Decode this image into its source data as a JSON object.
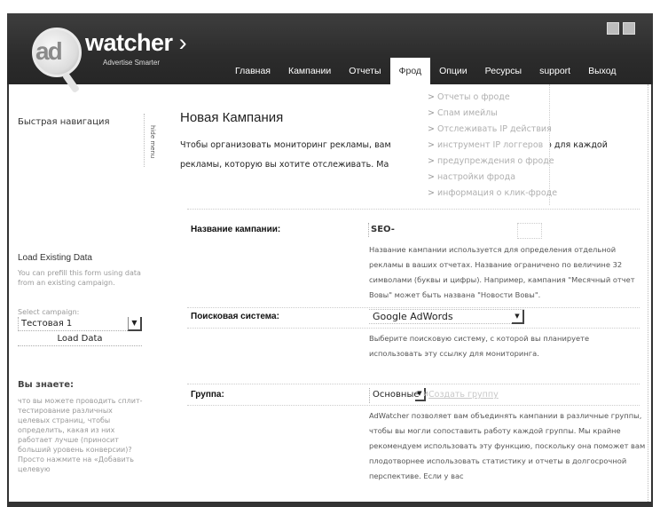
{
  "header": {
    "logo_ad": "ad",
    "logo_word": "watcher",
    "logo_chevron": "›",
    "tagline": "Advertise Smarter",
    "icons": [
      "print-icon",
      "window-icon"
    ]
  },
  "nav": {
    "items": [
      {
        "label": "Главная",
        "active": false
      },
      {
        "label": "Кампании",
        "active": false
      },
      {
        "label": "Отчеты",
        "active": false
      },
      {
        "label": "Фрод",
        "active": true
      },
      {
        "label": "Опции",
        "active": false
      },
      {
        "label": "Ресурсы",
        "active": false
      },
      {
        "label": "support",
        "active": false
      },
      {
        "label": "Выход",
        "active": false
      }
    ]
  },
  "fraud_menu": {
    "items": [
      "Отчеты о фроде",
      "Спам имейлы",
      "Отслеживать IP действия",
      "инструмент IP логгеров",
      "предупреждения о фроде",
      "настройки фрода",
      "информация о клик-фроде"
    ]
  },
  "sidebar": {
    "quick_nav": "Быстрая навигация",
    "hide_menu": "hide menu",
    "load_title": "Load Existing Data",
    "load_desc": "You can prefill this form using data from an existing campaign.",
    "select_label": "Select campaign:",
    "selected_campaign": "Тестовая 1",
    "load_button": "Load Data",
    "know_title": "Вы знаете:",
    "know_text": "что вы можете проводить сплит-тестирование различных целевых страниц, чтобы определить, какая из них работает лучше (приносит больший уровень конверсии)? Просто нажмите на «Добавить целевую"
  },
  "main": {
    "title": "Новая Кампания",
    "intro_line1": "Чтобы организовать мониторинг рекламы, вам",
    "intro_line1_end": "о для каждой",
    "intro_line2": "рекламы, которую вы хотите отслеживать. Ма",
    "campaign_name": {
      "label": "Название кампании:",
      "value": "SEO-",
      "help": "Название кампании используется для определения отдельной рекламы в ваших отчетах. Название ограничено по величине 32 символами (буквы и цифры). Например, кампания \"Месячный отчет Вовы\" может быть названа \"Новости Вовы\"."
    },
    "search_engine": {
      "label": "Поисковая система:",
      "value": "Google AdWords",
      "help": "Выберите поисковую систему, с которой вы планируете использовать эту ссылку для мониторинга."
    },
    "group": {
      "label": "Группа:",
      "value": "Основные",
      "and_text": "и",
      "create_link": "Создать группу",
      "help": "AdWatcher позволяет вам объединять кампании в различные группы, чтобы вы могли сопоставить работу каждой группы. Мы крайне рекомендуем использовать эту функцию, поскольку она поможет вам плодотворнее использовать статистику и отчеты в долгосрочной перспективе. Если у вас"
    }
  }
}
